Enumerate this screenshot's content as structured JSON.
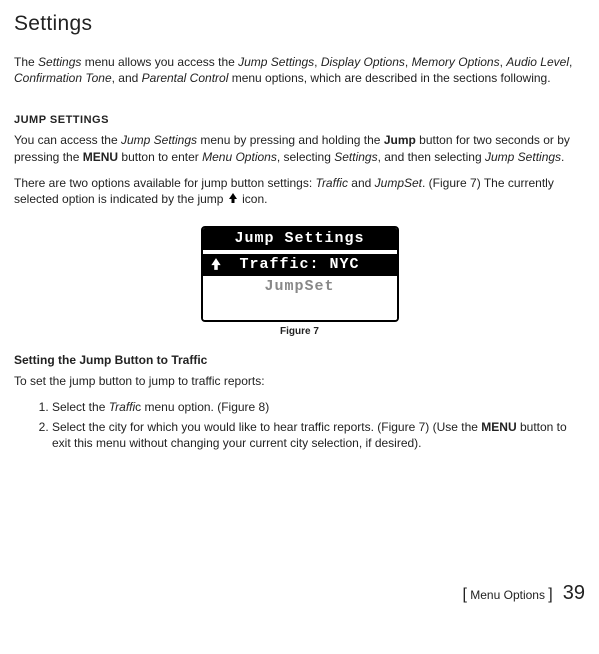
{
  "title": "Settings",
  "intro": {
    "part1": "The ",
    "settings": "Settings",
    "part2": " menu allows you access the ",
    "jump_settings": "Jump Settings",
    "c1": ", ",
    "display_options": "Display Options",
    "c2": ", ",
    "memory_options": "Memory Options",
    "c3": ", ",
    "audio_level": "Audio Level",
    "c4": ", ",
    "confirmation_tone": "Confirmation Tone",
    "c5": ", and ",
    "parental_control": "Parental Control",
    "part3": " menu options, which are described in the sections following."
  },
  "jump_heading": "JUMP SETTINGS",
  "jump_p1": {
    "part1": "You can access the ",
    "jump_settings": "Jump Settings",
    "part2": " menu by pressing and holding the ",
    "jump_btn": "Jump",
    "part3": " button for two seconds or by pressing the ",
    "menu_btn": "MENU",
    "part4": " button to enter ",
    "menu_options": "Menu Options",
    "part5": ", selecting ",
    "settings": "Settings",
    "part6": ", and then selecting ",
    "jump_settings2": "Jump Settings",
    "part7": "."
  },
  "jump_p2": {
    "part1": "There are two options available for jump button settings: ",
    "traffic": "Traffic",
    "and": " and ",
    "jumpset": "JumpSet",
    "part2": ". (Figure 7) The currently selected option is indicated by the jump ",
    "part3": " icon."
  },
  "figure": {
    "title_row": "Jump Settings",
    "selected_row": "Traffic: NYC",
    "option_row": "JumpSet",
    "caption": "Figure 7"
  },
  "traffic_heading": "Setting the Jump Button to Traffic",
  "traffic_intro": "To set the jump button to jump to traffic reports:",
  "steps": {
    "s1": {
      "part1": "Select the ",
      "traffic": "Traffi",
      "part2": "c menu option. (Figure 8)"
    },
    "s2": {
      "part1": "Select the city for which you would like to hear traffic reports. (Figure 7) (Use the ",
      "menu": "MENU",
      "part2": " button to exit this menu without changing your current city selection, if desired)."
    }
  },
  "footer": {
    "label": " Menu Options ",
    "page": "39"
  }
}
